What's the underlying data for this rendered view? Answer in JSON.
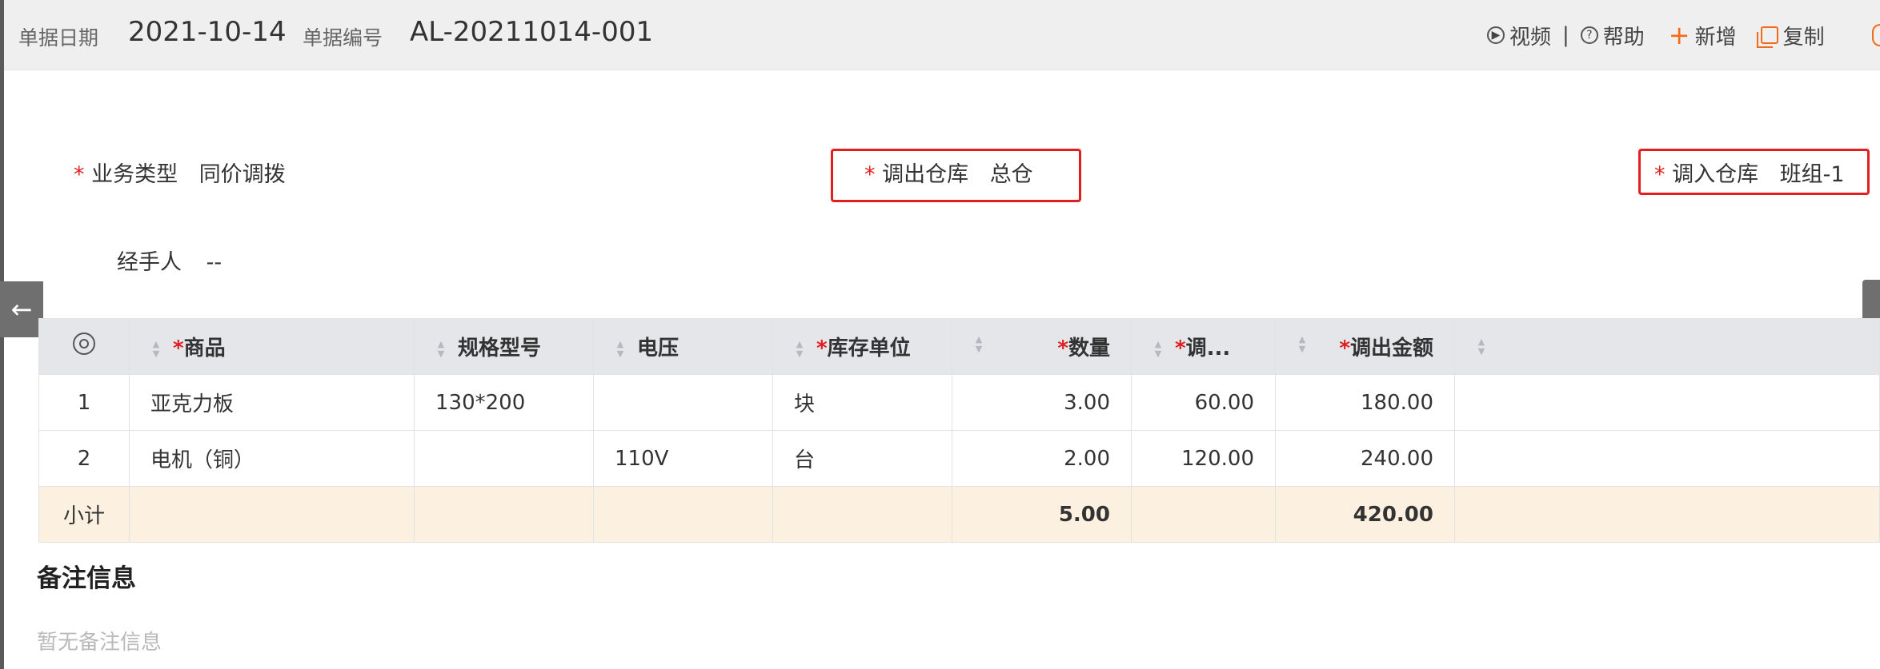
{
  "header": {
    "date_label": "单据日期",
    "date_value": "2021-10-14",
    "number_label": "单据编号",
    "number_value": "AL-20211014-001",
    "actions": {
      "video": "视频",
      "separator": "|",
      "help": "帮助",
      "add": "新增",
      "copy": "复制"
    }
  },
  "form": {
    "required_mark": "*",
    "business_type_label": "业务类型",
    "business_type_value": "同价调拨",
    "out_warehouse_label": "调出仓库",
    "out_warehouse_value": "总仓",
    "in_warehouse_label": "调入仓库",
    "in_warehouse_value": "班组-1",
    "handler_label": "经手人",
    "handler_value": "--"
  },
  "nav": {
    "back_arrow": "←"
  },
  "table": {
    "columns": [
      {
        "label": "商品",
        "required": true
      },
      {
        "label": "规格型号",
        "required": false
      },
      {
        "label": "电压",
        "required": false
      },
      {
        "label": "库存单位",
        "required": true
      },
      {
        "label": "数量",
        "required": true
      },
      {
        "label": "调...",
        "required": true
      },
      {
        "label": "调出金额",
        "required": true
      }
    ],
    "rows": [
      {
        "index": "1",
        "product": "亚克力板",
        "spec": "130*200",
        "voltage": "",
        "unit": "块",
        "qty": "3.00",
        "price": "60.00",
        "amount": "180.00"
      },
      {
        "index": "2",
        "product": "电机（铜）",
        "spec": "",
        "voltage": "110V",
        "unit": "台",
        "qty": "2.00",
        "price": "120.00",
        "amount": "240.00"
      }
    ],
    "subtotal": {
      "label": "小计",
      "qty": "5.00",
      "amount": "420.00"
    }
  },
  "remarks": {
    "title": "备注信息",
    "empty_text": "暂无备注信息"
  },
  "colors": {
    "required": "#e02020",
    "highlight_border": "#e41e1e",
    "accent": "#f26a1b",
    "subtotal_bg": "#fcf0e0",
    "header_bg": "#efefef"
  }
}
